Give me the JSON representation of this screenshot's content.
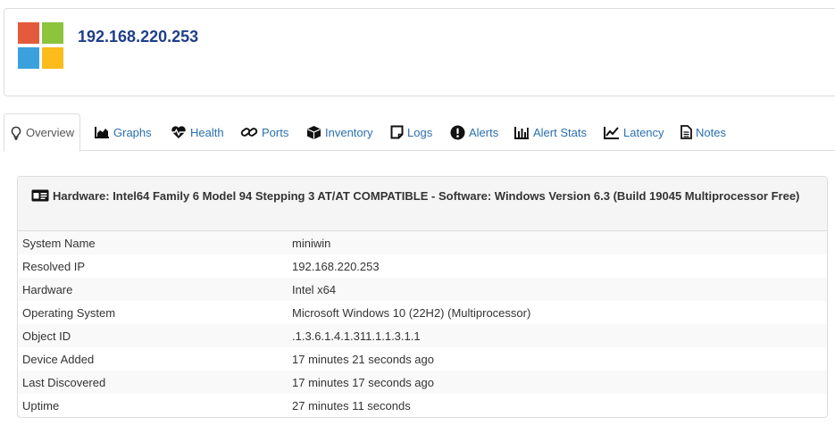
{
  "device": {
    "title": "192.168.220.253",
    "logo_colors": [
      "#e35b3c",
      "#8cc43c",
      "#3ba1dc",
      "#fbbc1c"
    ]
  },
  "tabs": [
    {
      "label": "Overview",
      "icon": "lightbulb-icon",
      "active": true
    },
    {
      "label": "Graphs",
      "icon": "area-chart-icon",
      "active": false
    },
    {
      "label": "Health",
      "icon": "heartbeat-icon",
      "active": false
    },
    {
      "label": "Ports",
      "icon": "link-icon",
      "active": false
    },
    {
      "label": "Inventory",
      "icon": "cube-icon",
      "active": false
    },
    {
      "label": "Logs",
      "icon": "note-icon",
      "active": false
    },
    {
      "label": "Alerts",
      "icon": "exclamation-circle-icon",
      "active": false
    },
    {
      "label": "Alert Stats",
      "icon": "bar-chart-icon",
      "active": false
    },
    {
      "label": "Latency",
      "icon": "line-chart-icon",
      "active": false
    },
    {
      "label": "Notes",
      "icon": "file-text-icon",
      "active": false
    }
  ],
  "overview": {
    "heading": "Hardware: Intel64 Family 6 Model 94 Stepping 3 AT/AT COMPATIBLE - Software: Windows Version 6.3 (Build 19045 Multiprocessor Free)",
    "rows": [
      {
        "label": "System Name",
        "value": "miniwin"
      },
      {
        "label": "Resolved IP",
        "value": "192.168.220.253"
      },
      {
        "label": "Hardware",
        "value": "Intel x64"
      },
      {
        "label": "Operating System",
        "value": "Microsoft Windows 10 (22H2) (Multiprocessor)"
      },
      {
        "label": "Object ID",
        "value": ".1.3.6.1.4.1.311.1.1.3.1.1"
      },
      {
        "label": "Device Added",
        "value": "17 minutes 21 seconds ago"
      },
      {
        "label": "Last Discovered",
        "value": "17 minutes 17 seconds ago"
      },
      {
        "label": "Uptime",
        "value": "27 minutes 11 seconds"
      }
    ]
  },
  "colors": {
    "link": "#2a6fb0",
    "title": "#1f3f8a",
    "border": "#dddddd"
  }
}
